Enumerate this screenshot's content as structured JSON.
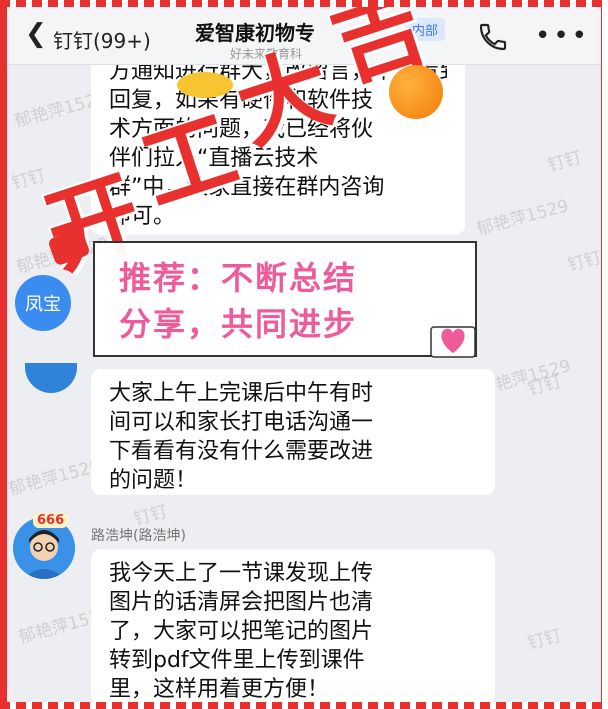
{
  "header": {
    "back_label": "钉钉(99+)",
    "title": "爱智康初物专",
    "badge": "内部",
    "subtitle": "好未来教育科"
  },
  "watermarks": [
    "郁艳萍1529",
    "钉钉",
    "郁艳萍1529",
    "钉钉",
    "郁艳萍1529",
    "钉钉",
    "郁艳萍1529",
    "钉钉",
    "郁艳萍1529",
    "钉钉",
    "郁艳萍1529",
    "钉钉"
  ],
  "messages": [
    {
      "lines": [
        "方通知进行群大，改留言，下课看到信息后及时",
        "回复，如果有硬件和软件技",
        "术方面的问题，我已经将伙",
        "伴们拉入“直播云技术",
        "群”中，大家直接在群内咨询",
        "即可。"
      ]
    },
    {
      "avatar_text": "凤宝"
    },
    {
      "lines": [
        "大家上午上完课后中午有时",
        "间可以和家长打电话沟通一",
        "下看看有没有什么需要改进",
        "的问题！"
      ]
    },
    {
      "sender": "路浩坤(路浩坤)",
      "avatar_badge": "666",
      "lines": [
        "我今天上了一节课发现上传",
        "图片的话清屏会把图片也清",
        "了，大家可以把笔记的图片",
        "转到pdf文件里上传到课件",
        "里，这样用着更方便！"
      ]
    }
  ],
  "stamp": {
    "chars": [
      "开",
      "工",
      "大",
      "吉"
    ],
    "color": "#e8312f"
  },
  "recommend": {
    "line1": "推荐：不断总结",
    "line2": "分享，共同进步",
    "color": "#ef5a9a"
  }
}
